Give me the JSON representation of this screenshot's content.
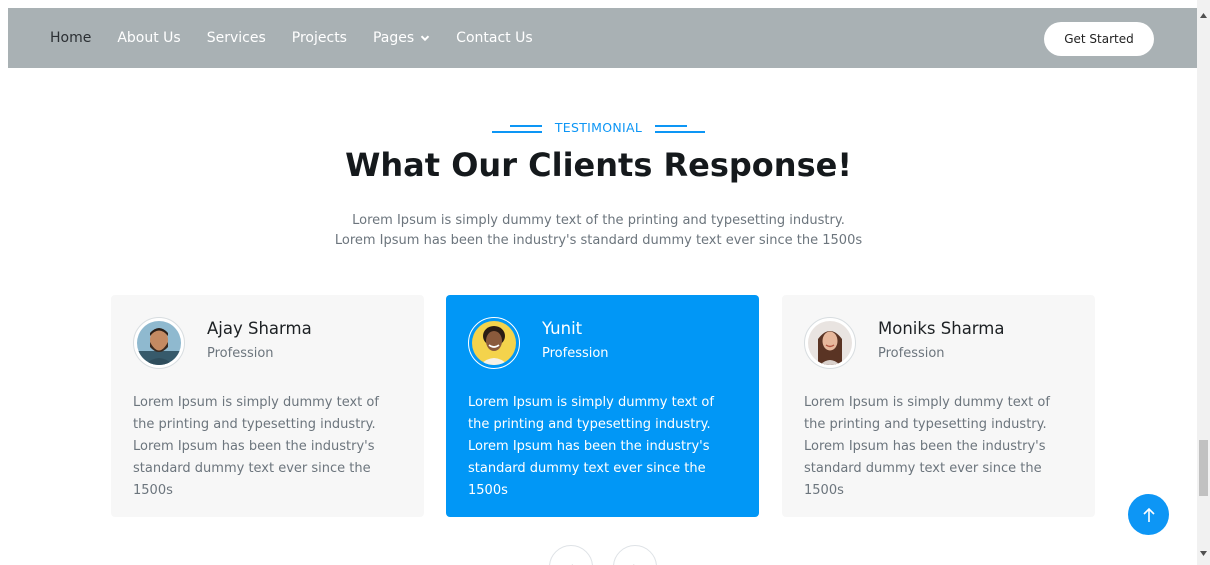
{
  "nav": {
    "links": [
      {
        "label": "Home",
        "active": true
      },
      {
        "label": "About Us"
      },
      {
        "label": "Services"
      },
      {
        "label": "Projects"
      },
      {
        "label": "Pages",
        "dropdown": true
      },
      {
        "label": "Contact Us"
      }
    ],
    "cta": "Get Started"
  },
  "section": {
    "eyebrow": "TESTIMONIAL",
    "title": "What Our Clients Response!",
    "subtitle_line1": "Lorem Ipsum is simply dummy text of the printing and typesetting industry.",
    "subtitle_line2": "Lorem Ipsum has been the industry's standard dummy text ever since the 1500s"
  },
  "testimonials": [
    {
      "name": "Ajay Sharma",
      "role": "Profession",
      "text": "Lorem Ipsum is simply dummy text of the printing and typesetting industry. Lorem Ipsum has been the industry's standard dummy text ever since the 1500s"
    },
    {
      "name": "Yunit",
      "role": "Profession",
      "text": "Lorem Ipsum is simply dummy text of the printing and typesetting industry. Lorem Ipsum has been the industry's standard dummy text ever since the 1500s",
      "featured": true
    },
    {
      "name": "Moniks Sharma",
      "role": "Profession",
      "text": "Lorem Ipsum is simply dummy text of the printing and typesetting industry. Lorem Ipsum has been the industry's standard dummy text ever since the 1500s"
    }
  ],
  "icons": {
    "pages_dropdown": "chevron-down-icon",
    "back_to_top": "arrow-up-icon",
    "carousel_prev": "chevron-left-icon",
    "carousel_next": "chevron-right-icon"
  },
  "colors": {
    "accent": "#0d96f5",
    "featured_card": "#0197f6",
    "navbar": "#a9b1b4"
  }
}
